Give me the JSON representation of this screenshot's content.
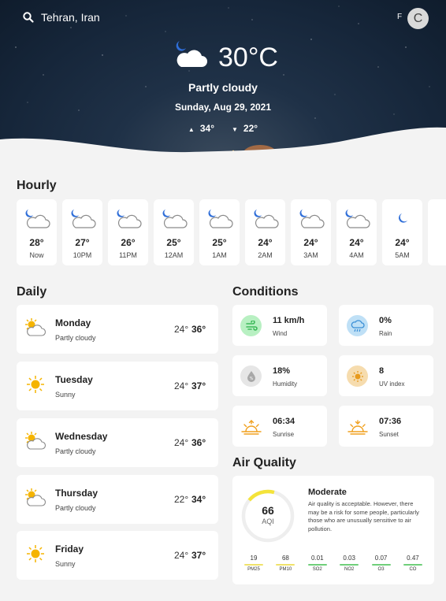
{
  "search": {
    "location": "Tehran, Iran"
  },
  "header": {
    "unit": "F",
    "avatar_initial": "C"
  },
  "current": {
    "icon": "moon-cloud-icon",
    "temperature": "30°C",
    "condition": "Partly cloudy",
    "date": "Sunday, Aug 29, 2021",
    "high": "34°",
    "low": "22°"
  },
  "hourly": {
    "title": "Hourly",
    "items": [
      {
        "temp": "28°",
        "time": "Now",
        "icon": "moon-cloud-icon"
      },
      {
        "temp": "27°",
        "time": "10PM",
        "icon": "moon-cloud-icon"
      },
      {
        "temp": "26°",
        "time": "11PM",
        "icon": "moon-cloud-icon"
      },
      {
        "temp": "25°",
        "time": "12AM",
        "icon": "moon-cloud-icon"
      },
      {
        "temp": "25°",
        "time": "1AM",
        "icon": "moon-cloud-icon"
      },
      {
        "temp": "24°",
        "time": "2AM",
        "icon": "moon-cloud-icon"
      },
      {
        "temp": "24°",
        "time": "3AM",
        "icon": "moon-cloud-icon"
      },
      {
        "temp": "24°",
        "time": "4AM",
        "icon": "moon-cloud-icon"
      },
      {
        "temp": "24°",
        "time": "5AM",
        "icon": "moon-icon"
      }
    ]
  },
  "daily": {
    "title": "Daily",
    "items": [
      {
        "day": "Monday",
        "desc": "Partly cloudy",
        "low": "24°",
        "high": "36°",
        "icon": "sun-cloud-icon"
      },
      {
        "day": "Tuesday",
        "desc": "Sunny",
        "low": "24°",
        "high": "37°",
        "icon": "sun-icon"
      },
      {
        "day": "Wednesday",
        "desc": "Partly cloudy",
        "low": "24°",
        "high": "36°",
        "icon": "sun-cloud-icon"
      },
      {
        "day": "Thursday",
        "desc": "Partly cloudy",
        "low": "22°",
        "high": "34°",
        "icon": "sun-cloud-icon"
      },
      {
        "day": "Friday",
        "desc": "Sunny",
        "low": "24°",
        "high": "37°",
        "icon": "sun-icon"
      }
    ]
  },
  "conditions": {
    "title": "Conditions",
    "wind": {
      "value": "11 km/h",
      "label": "Wind",
      "icon": "wind-icon",
      "color": "#b8f0c2"
    },
    "rain": {
      "value": "0%",
      "label": "Rain",
      "icon": "rain-cloud-icon",
      "color": "#bfe0f6"
    },
    "humidity": {
      "value": "18%",
      "label": "Humidity",
      "icon": "droplet-icon",
      "color": "#e6e6e6"
    },
    "uv": {
      "value": "8",
      "label": "UV index",
      "icon": "uv-sun-icon",
      "color": "#f6dcae"
    },
    "sunrise": {
      "value": "06:34",
      "label": "Sunrise",
      "icon": "sunrise-icon"
    },
    "sunset": {
      "value": "07:36",
      "label": "Sunset",
      "icon": "sunset-icon"
    }
  },
  "air_quality": {
    "title": "Air Quality",
    "aqi": "66",
    "aqi_label": "AQI",
    "aqi_fraction": 0.18,
    "level": "Moderate",
    "description": "Air quality is acceptable. However, there may be a risk for some people, particularly those who are unusually sensitive to air pollution.",
    "pollutants": [
      {
        "value": "19",
        "name": "PM25",
        "color": "#f0e26a"
      },
      {
        "value": "68",
        "name": "PM10",
        "color": "#f0e26a"
      },
      {
        "value": "0.01",
        "name": "SO2",
        "color": "#6fcf7a"
      },
      {
        "value": "0.03",
        "name": "NO2",
        "color": "#6fcf7a"
      },
      {
        "value": "0.07",
        "name": "O3",
        "color": "#6fcf7a"
      },
      {
        "value": "0.47",
        "name": "CO",
        "color": "#6fcf7a"
      }
    ]
  }
}
